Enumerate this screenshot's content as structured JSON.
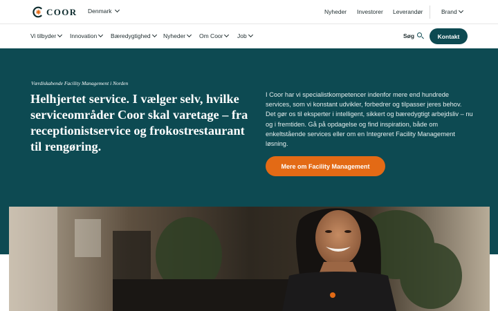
{
  "header": {
    "logo_text": "COOR",
    "country": "Denmark",
    "utility_links": [
      {
        "label": "Nyheder"
      },
      {
        "label": "Investorer"
      },
      {
        "label": "Leverandør"
      }
    ],
    "brand_label": "Brand"
  },
  "nav": {
    "items": [
      {
        "label": "Vi tilbyder"
      },
      {
        "label": "Innovation"
      },
      {
        "label": "Bæredygtighed"
      },
      {
        "label": "Nyheder"
      },
      {
        "label": "Om Coor"
      },
      {
        "label": "Job"
      }
    ],
    "search_label": "Søg",
    "contact_label": "Kontakt"
  },
  "hero": {
    "kicker": "Værdiskabende Facility Management i Norden",
    "headline": "Helhjertet service. I vælger selv, hvilke serviceområder Coor skal varetage – fra receptionistservice og frokostrestaurant til rengøring.",
    "body": "I Coor har vi specialistkompetencer indenfor mere end hundrede services, som vi konstant udvikler, forbedrer og tilpasser jeres behov. Det gør os til eksperter i intelligent, sikkert og bæredygtigt arbejdsliv – nu og i fremtiden. Gå på opdagelse og find inspiration, både om enkeltstående services eller om en Integreret Facility Management løsning.",
    "cta_label": "Mere om Facility Management"
  },
  "colors": {
    "teal": "#0d4a52",
    "orange": "#e36a15"
  }
}
